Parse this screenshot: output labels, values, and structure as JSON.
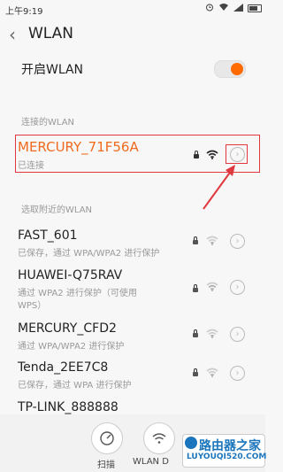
{
  "status_bar": {
    "time": "上午9:19"
  },
  "header": {
    "title": "WLAN"
  },
  "toggle": {
    "label": "开启WLAN",
    "state": "on"
  },
  "sections": {
    "connected": "连接的WLAN",
    "nearby": "选取附近的WLAN"
  },
  "connected_network": {
    "name": "MERCURY_71F56A",
    "status": "已连接",
    "secured": true
  },
  "networks": [
    {
      "name": "FAST_601",
      "detail": "已保存，通过 WPA/WPA2 进行保护"
    },
    {
      "name": "HUAWEI-Q75RAV",
      "detail": "通过 WPA2 进行保护（可使用",
      "detail2": "WPS）"
    },
    {
      "name": "MERCURY_CFD2",
      "detail": "通过 WPA/WPA2 进行保护"
    },
    {
      "name": "Tenda_2EE7C8",
      "detail": "已保存，通过 WPA 进行保护"
    },
    {
      "name": "TP-LINK_888888",
      "detail": ""
    }
  ],
  "bottom_bar": {
    "scan_label": "扫描",
    "wlan_label": "WLAN D"
  },
  "watermark": {
    "title": "路由器之家",
    "url": "LUYOUQI520.COM"
  },
  "colors": {
    "accent": "#ff6a00",
    "highlight": "#e0383e",
    "connected_name": "#f06a1e",
    "watermark": "#1b75bc"
  }
}
